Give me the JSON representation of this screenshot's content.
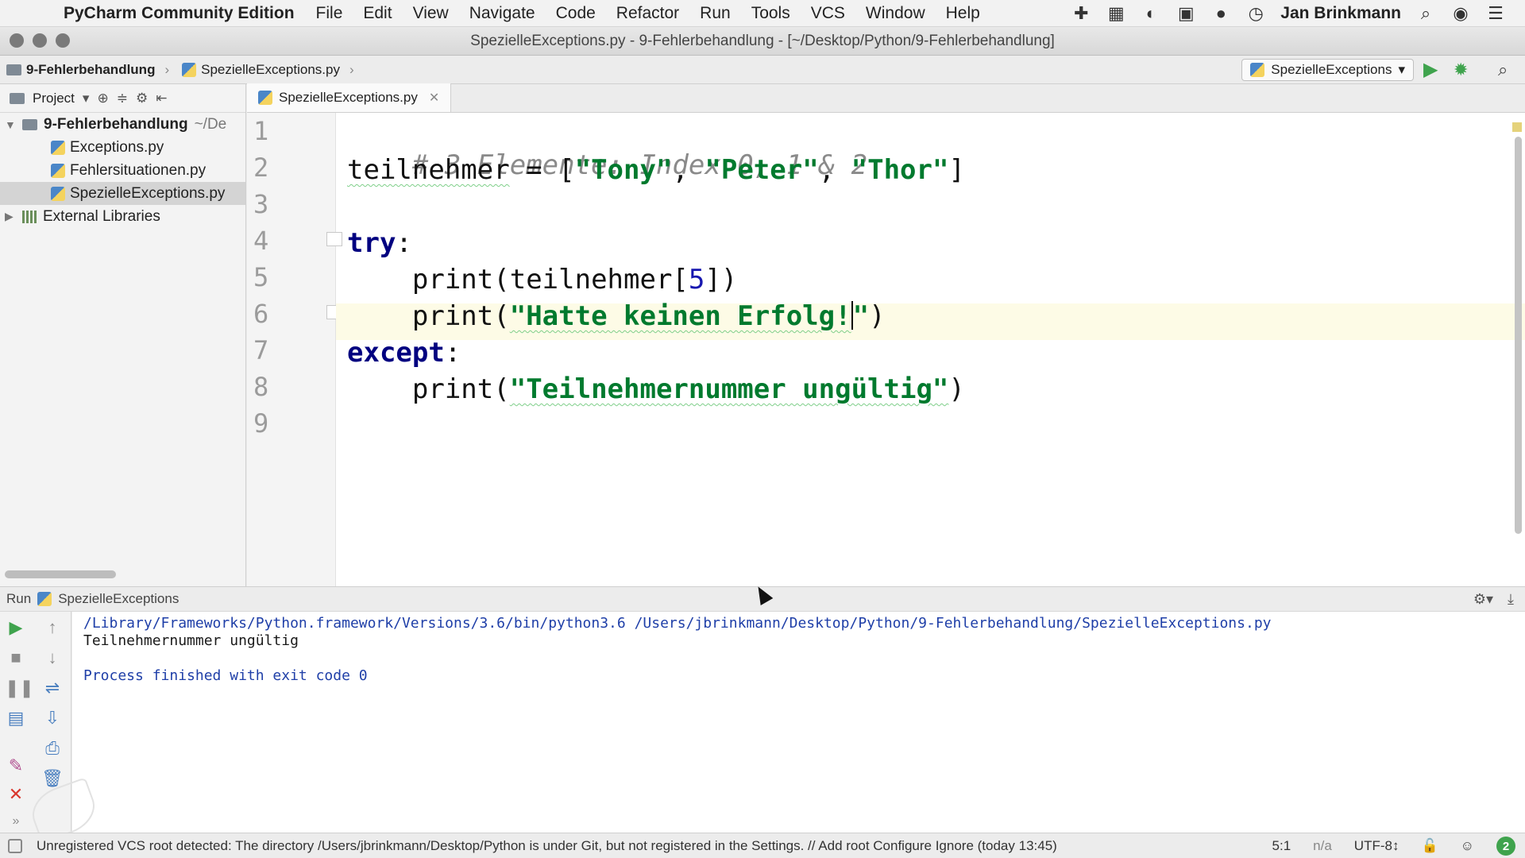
{
  "menubar": {
    "app_name": "PyCharm Community Edition",
    "items": [
      "File",
      "Edit",
      "View",
      "Navigate",
      "Code",
      "Refactor",
      "Run",
      "Tools",
      "VCS",
      "Window",
      "Help"
    ],
    "user": "Jan Brinkmann"
  },
  "window": {
    "title": "SpezielleExceptions.py - 9-Fehlerbehandlung - [~/Desktop/Python/9-Fehlerbehandlung]"
  },
  "navbar": {
    "crumb_project": "9-Fehlerbehandlung",
    "crumb_file": "SpezielleExceptions.py",
    "run_config": "SpezielleExceptions"
  },
  "project": {
    "header_label": "Project",
    "root_name": "9-Fehlerbehandlung",
    "root_path": "~/De",
    "files": [
      "Exceptions.py",
      "Fehlersituationen.py",
      "SpezielleExceptions.py"
    ],
    "external_libraries": "External Libraries"
  },
  "editor": {
    "tab_label": "SpezielleExceptions.py",
    "line_numbers": [
      "1",
      "2",
      "3",
      "4",
      "5",
      "6",
      "7",
      "8",
      "9"
    ],
    "comment": "# 3 Elemente: Index 0, 1 & 2",
    "var_name": "teilnehmer",
    "assign": " = [",
    "str_tony": "\"Tony\"",
    "str_peter": "\"Peter\"",
    "str_thor": "\"Thor\"",
    "comma": ", ",
    "close_bracket": "]",
    "kw_try": "try",
    "kw_except": "except",
    "colon": ":",
    "indent": "    ",
    "print_open": "print(",
    "index_expr_a": "teilnehmer[",
    "index_num": "5",
    "index_expr_b": "])",
    "str_fail": "\"Hatte keinen Erfolg!",
    "str_fail_end": "\"",
    "str_invalid": "\"Teilnehmernummer ungültig\"",
    "paren_close": ")"
  },
  "run_panel": {
    "label": "Run",
    "config_name": "SpezielleExceptions",
    "command": "/Library/Frameworks/Python.framework/Versions/3.6/bin/python3.6 /Users/jbrinkmann/Desktop/Python/9-Fehlerbehandlung/SpezielleExceptions.py",
    "output": "Teilnehmernummer ungültig",
    "process": "Process finished with exit code 0"
  },
  "statusbar": {
    "message": "Unregistered VCS root detected: The directory /Users/jbrinkmann/Desktop/Python is under Git, but not registered in the Settings. // Add root  Configure  Ignore (today 13:45)",
    "position": "5:1",
    "separator": "n/a",
    "encoding": "UTF-8↕",
    "badge": "2"
  },
  "colors": {
    "keyword": "#000080",
    "string": "#007a2e",
    "number": "#1818b0",
    "comment": "#8a8a8a",
    "run_green": "#3fa34d",
    "stop_red": "#d9372e"
  }
}
